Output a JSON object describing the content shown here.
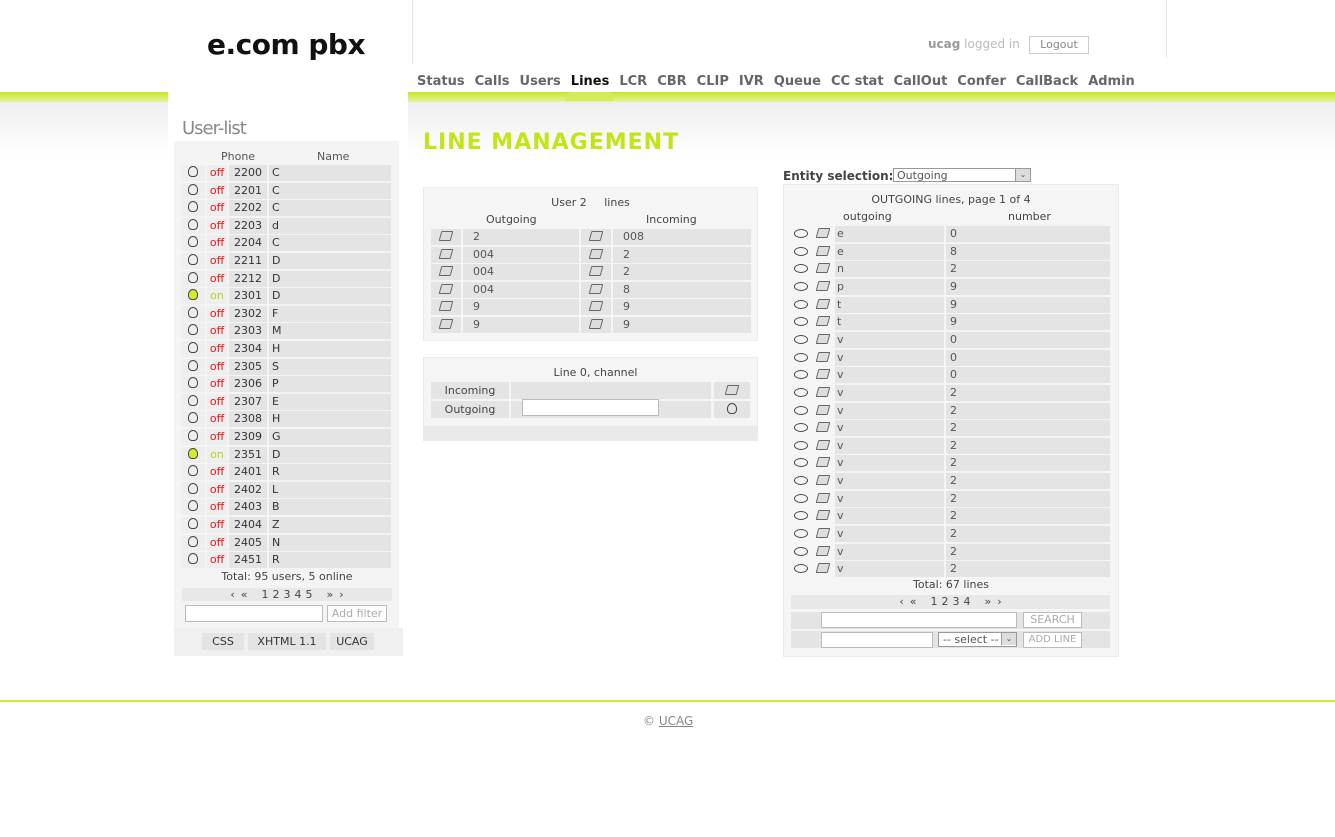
{
  "header": {
    "logo": "e.com pbx",
    "user": "ucag",
    "login_suffix": "logged in",
    "logout_label": "Logout"
  },
  "nav": [
    {
      "label": "Status",
      "active": false
    },
    {
      "label": "Calls",
      "active": false
    },
    {
      "label": "Users",
      "active": false
    },
    {
      "label": "Lines",
      "active": true
    },
    {
      "label": "LCR",
      "active": false
    },
    {
      "label": "CBR",
      "active": false
    },
    {
      "label": "CLIP",
      "active": false
    },
    {
      "label": "IVR",
      "active": false
    },
    {
      "label": "Queue",
      "active": false
    },
    {
      "label": "CC stat",
      "active": false
    },
    {
      "label": "CallOut",
      "active": false
    },
    {
      "label": "Confer",
      "active": false
    },
    {
      "label": "CallBack",
      "active": false
    },
    {
      "label": "Admin",
      "active": false
    }
  ],
  "userlist": {
    "title": "User-list",
    "col_phone": "Phone",
    "col_name": "Name",
    "rows": [
      {
        "status": "off",
        "phone": "2200",
        "name": "C"
      },
      {
        "status": "off",
        "phone": "2201",
        "name": "C"
      },
      {
        "status": "off",
        "phone": "2202",
        "name": "C"
      },
      {
        "status": "off",
        "phone": "2203",
        "name": "d"
      },
      {
        "status": "off",
        "phone": "2204",
        "name": "C"
      },
      {
        "status": "off",
        "phone": "2211",
        "name": "D"
      },
      {
        "status": "off",
        "phone": "2212",
        "name": "D"
      },
      {
        "status": "on",
        "phone": "2301",
        "name": "D"
      },
      {
        "status": "off",
        "phone": "2302",
        "name": "F"
      },
      {
        "status": "off",
        "phone": "2303",
        "name": "M"
      },
      {
        "status": "off",
        "phone": "2304",
        "name": "H"
      },
      {
        "status": "off",
        "phone": "2305",
        "name": "S"
      },
      {
        "status": "off",
        "phone": "2306",
        "name": "P"
      },
      {
        "status": "off",
        "phone": "2307",
        "name": "E"
      },
      {
        "status": "off",
        "phone": "2308",
        "name": "H"
      },
      {
        "status": "off",
        "phone": "2309",
        "name": "G"
      },
      {
        "status": "on",
        "phone": "2351",
        "name": "D"
      },
      {
        "status": "off",
        "phone": "2401",
        "name": "R"
      },
      {
        "status": "off",
        "phone": "2402",
        "name": "L"
      },
      {
        "status": "off",
        "phone": "2403",
        "name": "B"
      },
      {
        "status": "off",
        "phone": "2404",
        "name": "Z"
      },
      {
        "status": "off",
        "phone": "2405",
        "name": "N"
      },
      {
        "status": "off",
        "phone": "2451",
        "name": "R"
      }
    ],
    "total": "Total: 95 users, 5 online",
    "pager": {
      "first": "‹",
      "prev": "«",
      "pages": [
        "1",
        "2",
        "3",
        "4",
        "5"
      ],
      "next": "»",
      "last": "›"
    },
    "filter_button": "Add filter"
  },
  "footer_buttons": [
    "CSS",
    "XHTML 1.1",
    "UCAG"
  ],
  "page_title": "LINE MANAGEMENT",
  "user_lines": {
    "title_prefix": "User",
    "user": "2",
    "title_suffix": "lines",
    "col_outgoing": "Outgoing",
    "col_incoming": "Incoming",
    "rows": [
      {
        "outgoing": "2",
        "incoming": "008"
      },
      {
        "outgoing": "004",
        "incoming": "2"
      },
      {
        "outgoing": "004",
        "incoming": "2"
      },
      {
        "outgoing": "004",
        "incoming": "8"
      },
      {
        "outgoing": "9",
        "incoming": "9"
      },
      {
        "outgoing": "9",
        "incoming": "9"
      }
    ]
  },
  "channel": {
    "title": "Line 0, channel",
    "incoming_label": "Incoming",
    "outgoing_label": "Outgoing"
  },
  "entity": {
    "label": "Entity selection:",
    "selected": "Outgoing"
  },
  "outgoing_lines": {
    "title": "OUTGOING lines, page 1 of 4",
    "col_outgoing": "outgoing",
    "col_number": "number",
    "rows": [
      {
        "name": "e",
        "number": "0"
      },
      {
        "name": "e",
        "number": "8"
      },
      {
        "name": "n",
        "number": "2"
      },
      {
        "name": "p",
        "number": "9"
      },
      {
        "name": "t",
        "number": "9"
      },
      {
        "name": "t",
        "number": "9"
      },
      {
        "name": "v",
        "number": "0"
      },
      {
        "name": "v",
        "number": "0"
      },
      {
        "name": "v",
        "number": "0"
      },
      {
        "name": "v",
        "number": "2"
      },
      {
        "name": "v",
        "number": "2"
      },
      {
        "name": "v",
        "number": "2"
      },
      {
        "name": "v",
        "number": "2"
      },
      {
        "name": "v",
        "number": "2"
      },
      {
        "name": "v",
        "number": "2"
      },
      {
        "name": "v",
        "number": "2"
      },
      {
        "name": "v",
        "number": "2"
      },
      {
        "name": "v",
        "number": "2"
      },
      {
        "name": "v",
        "number": "2"
      },
      {
        "name": "v",
        "number": "2"
      }
    ],
    "total": "Total: 67 lines",
    "pager": {
      "first": "‹",
      "prev": "«",
      "pages": [
        "1",
        "2",
        "3",
        "4"
      ],
      "next": "»",
      "last": "›"
    },
    "search_button": "SEARCH",
    "select_placeholder": "-- select --",
    "add_button": "ADD LINE"
  },
  "footer": {
    "copyright": "©",
    "link": "UCAG"
  }
}
